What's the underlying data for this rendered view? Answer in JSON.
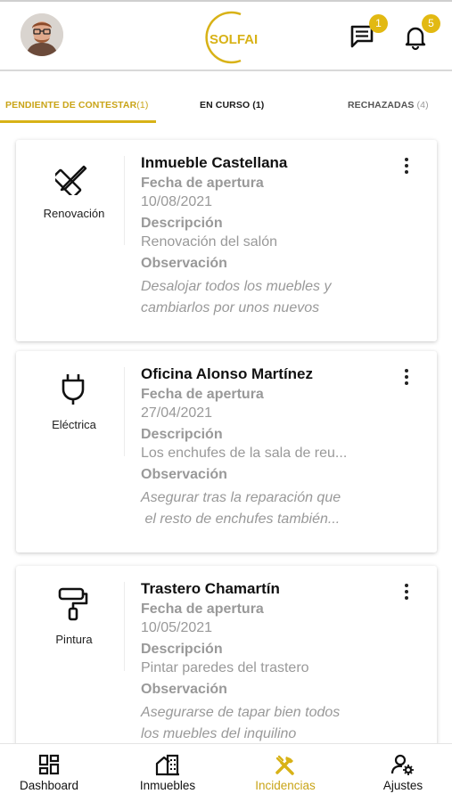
{
  "header": {
    "logo_text": "SOLFAI",
    "messages_badge": "1",
    "notifications_badge": "5",
    "accent_color": "#d8b217"
  },
  "tabs": [
    {
      "label": "PENDIENTE DE CONTESTAR",
      "count": "(1)",
      "active": true
    },
    {
      "label": "EN CURSO",
      "count": "(1)",
      "active": false
    },
    {
      "label": "RECHAZADAS",
      "count": "(4)",
      "active": false
    }
  ],
  "incidents": [
    {
      "category_icon": "ruler-pencil-icon",
      "category": "Renovación",
      "title": "Inmueble Castellana",
      "opening_label": "Fecha de apertura",
      "opening_date": "10/08/2021",
      "description_label": "Descripción",
      "description": "Renovación del salón",
      "observation_label": "Observación",
      "observation_line1": "Desalojar todos los muebles y",
      "observation_line2": "cambiarlos por unos nuevos"
    },
    {
      "category_icon": "plug-icon",
      "category": "Eléctrica",
      "title": "Oficina Alonso Martínez",
      "opening_label": "Fecha de apertura",
      "opening_date": "27/04/2021",
      "description_label": "Descripción",
      "description": "Los enchufes de la sala de reu...",
      "observation_label": "Observación",
      "observation_line1": "Asegurar tras la reparación que",
      "observation_line2": " el resto de enchufes también..."
    },
    {
      "category_icon": "paint-roller-icon",
      "category": "Pintura",
      "title": "Trastero Chamartín",
      "opening_label": "Fecha de apertura",
      "opening_date": "10/05/2021",
      "description_label": "Descripción",
      "description": "Pintar paredes del trastero",
      "observation_label": "Observación",
      "observation_line1": "Asegurarse de tapar bien todos",
      "observation_line2": "los muebles del inquilino"
    }
  ],
  "bottom_nav": [
    {
      "label": "Dashboard",
      "icon": "dashboard-icon",
      "active": false
    },
    {
      "label": "Inmuebles",
      "icon": "buildings-icon",
      "active": false
    },
    {
      "label": "Incidencias",
      "icon": "tools-icon",
      "active": true
    },
    {
      "label": "Ajustes",
      "icon": "user-settings-icon",
      "active": false
    }
  ]
}
